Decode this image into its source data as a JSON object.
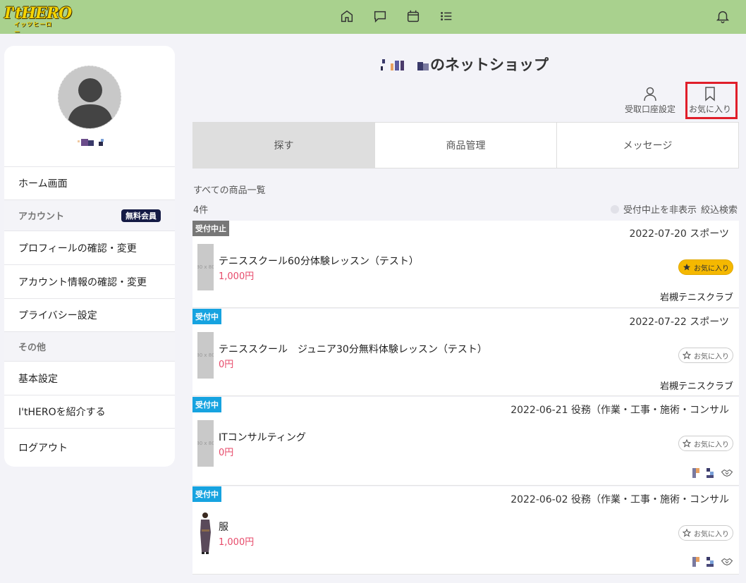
{
  "app": {
    "logo_main": "I'tHERO",
    "logo_sub": "イッツヒーロー"
  },
  "topnav": [
    "home-icon",
    "chat-icon",
    "calendar-icon",
    "list-icon",
    "bell-icon"
  ],
  "sidebar": {
    "menu": [
      {
        "label": "ホーム画面",
        "type": "item"
      },
      {
        "label": "アカウント",
        "type": "head",
        "badge": "無料会員"
      },
      {
        "label": "プロフィールの確認・変更",
        "type": "item"
      },
      {
        "label": "アカウント情報の確認・変更",
        "type": "item"
      },
      {
        "label": "プライバシー設定",
        "type": "item"
      },
      {
        "label": "その他",
        "type": "head"
      },
      {
        "label": "基本設定",
        "type": "item"
      },
      {
        "label": "I'tHEROを紹介する",
        "type": "item"
      },
      {
        "label": "ログアウト",
        "type": "item"
      }
    ]
  },
  "shop": {
    "title_suffix": "のネットショップ"
  },
  "actions": {
    "account_settings": "受取口座設定",
    "favorites": "お気に入り"
  },
  "tabs": [
    "探す",
    "商品管理",
    "メッセージ"
  ],
  "list": {
    "heading": "すべての商品一覧",
    "count": "4件",
    "hide_closed": "受付中止を非表示",
    "filter": "絞込検索",
    "thumb_placeholder": "80 x 80",
    "fav_label": "お気に入り",
    "items": [
      {
        "status": "受付中止",
        "status_type": "closed",
        "meta": "2022-07-20  スポーツ",
        "name": "テニススクール60分体験レッスン（テスト）",
        "price": "1,000円",
        "favorited": true,
        "seller": "岩槻テニスクラブ"
      },
      {
        "status": "受付中",
        "status_type": "open",
        "meta": "2022-07-22  スポーツ",
        "name": "テニススクール　ジュニア30分無料体験レッスン（テスト）",
        "price": "0円",
        "favorited": false,
        "seller": "岩槻テニスクラブ"
      },
      {
        "status": "受付中",
        "status_type": "open",
        "meta": "2022-06-21  役務（作業・工事・施術・コンサル",
        "name": "ITコンサルティング",
        "price": "0円",
        "favorited": false,
        "seller": ""
      },
      {
        "status": "受付中",
        "status_type": "open",
        "meta": "2022-06-02  役務（作業・工事・施術・コンサル",
        "name": "服",
        "price": "1,000円",
        "favorited": false,
        "seller": ""
      }
    ]
  },
  "colors": {
    "topbar": "#a9d18e",
    "open": "#16a3e0",
    "closed": "#777777",
    "price": "#e74a6a",
    "highlight": "#e01e2a",
    "fav_on": "#f5b800"
  }
}
